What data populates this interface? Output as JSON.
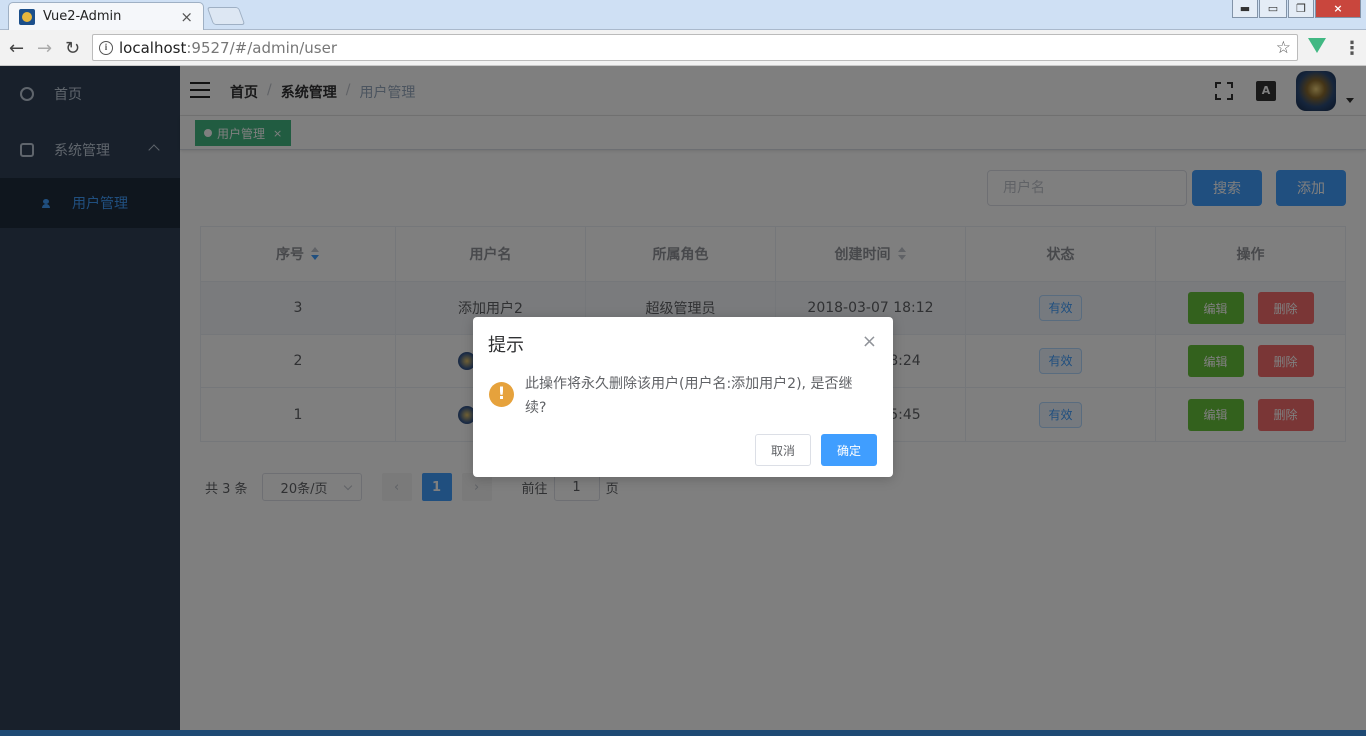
{
  "browser": {
    "tab_title": "Vue2-Admin",
    "url_host": "localhost",
    "url_rest": ":9527/#/admin/user"
  },
  "sidebar": {
    "items": [
      {
        "label": "首页",
        "icon": "dashboard-icon"
      },
      {
        "label": "系统管理",
        "icon": "settings-icon"
      },
      {
        "label": "用户管理",
        "icon": "user-icon"
      }
    ]
  },
  "navbar": {
    "breadcrumb": [
      "首页",
      "系统管理",
      "用户管理"
    ],
    "lang_label": "A"
  },
  "tags": [
    {
      "label": "用户管理",
      "active": true
    }
  ],
  "filter": {
    "placeholder": "用户名",
    "search_label": "搜索",
    "add_label": "添加"
  },
  "table": {
    "columns": [
      "序号",
      "用户名",
      "所属角色",
      "创建时间",
      "状态",
      "操作"
    ],
    "rows": [
      {
        "id": "3",
        "username": "添加用户2",
        "role": "超级管理员",
        "created": "2018-03-07 18:12",
        "status": "有效"
      },
      {
        "id": "2",
        "username": "",
        "role": "",
        "created": "18:24",
        "status": "有效"
      },
      {
        "id": "1",
        "username": "",
        "role": "",
        "created": "15:45",
        "status": "有效"
      }
    ],
    "edit_label": "编辑",
    "delete_label": "删除"
  },
  "pagination": {
    "total_text": "共 3 条",
    "page_size": "20条/页",
    "current_page": "1",
    "jump_prefix": "前往",
    "jump_value": "1",
    "jump_suffix": "页"
  },
  "dialog": {
    "title": "提示",
    "message": "此操作将永久删除该用户(用户名:添加用户2), 是否继续?",
    "cancel_label": "取消",
    "confirm_label": "确定"
  },
  "colors": {
    "sidebar_bg": "#304156",
    "primary": "#409eff",
    "success": "#67c23a",
    "danger": "#f56c6c",
    "warning": "#e6a23c",
    "tag": "#42b983"
  }
}
